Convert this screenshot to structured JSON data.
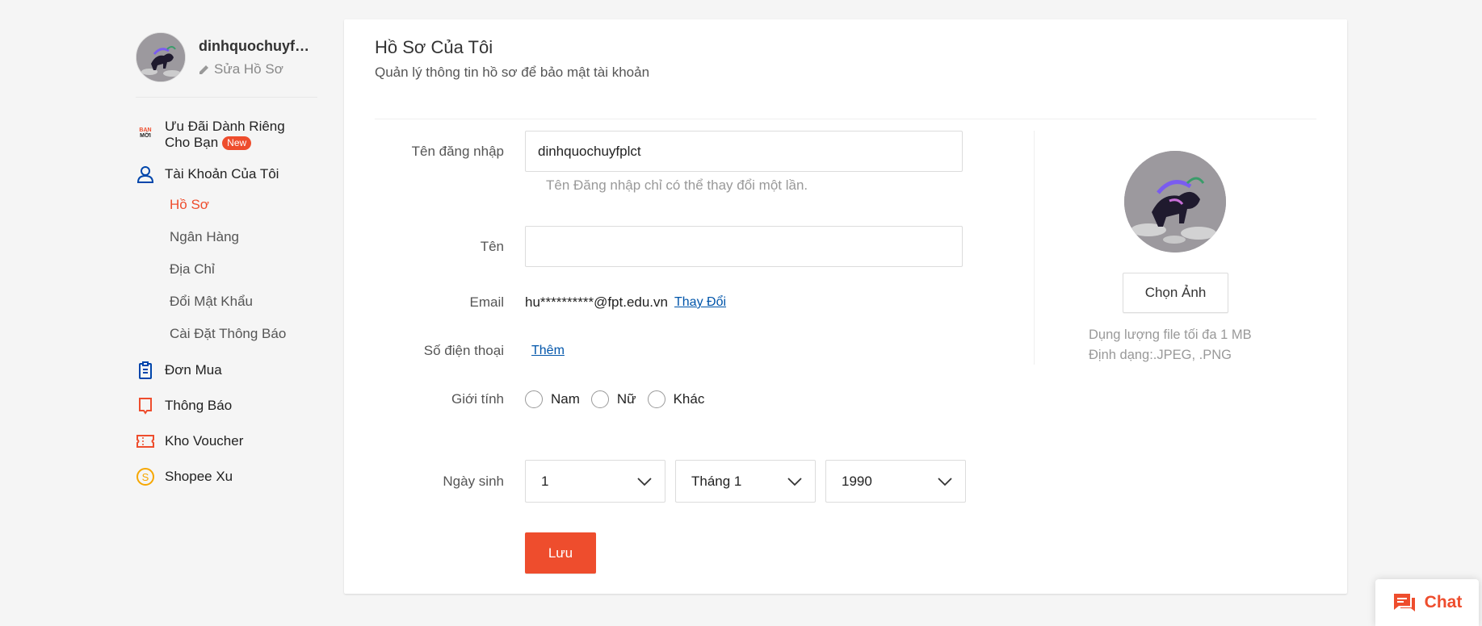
{
  "user": {
    "username": "dinhquochuyfplct",
    "edit_profile": "Sửa Hồ Sơ"
  },
  "sidebar": {
    "promo_icon_text": [
      "BẠN",
      "MỚI"
    ],
    "promo_label_line1": "Ưu Đãi Dành Riêng",
    "promo_label_line2": "Cho Bạn",
    "promo_badge": "New",
    "account": "Tài Khoản Của Tôi",
    "account_items": [
      {
        "label": "Hồ Sơ",
        "active": true
      },
      {
        "label": "Ngân Hàng",
        "active": false
      },
      {
        "label": "Địa Chỉ",
        "active": false
      },
      {
        "label": "Đổi Mật Khẩu",
        "active": false
      },
      {
        "label": "Cài Đặt Thông Báo",
        "active": false
      }
    ],
    "orders": "Đơn Mua",
    "notifications": "Thông Báo",
    "vouchers": "Kho Voucher",
    "coins": "Shopee Xu"
  },
  "header": {
    "title": "Hồ Sơ Của Tôi",
    "subtitle": "Quản lý thông tin hồ sơ để bảo mật tài khoản"
  },
  "form": {
    "username_label": "Tên đăng nhập",
    "username_value": "dinhquochuyfplct",
    "username_hint": "Tên Đăng nhập chỉ có thể thay đổi một lần.",
    "name_label": "Tên",
    "name_value": "",
    "email_label": "Email",
    "email_value": "hu**********@fpt.edu.vn",
    "email_change": "Thay Đổi",
    "phone_label": "Số điện thoại",
    "phone_add": "Thêm",
    "gender_label": "Giới tính",
    "gender_options": [
      "Nam",
      "Nữ",
      "Khác"
    ],
    "birthday_label": "Ngày sinh",
    "birthday_day": "1",
    "birthday_month": "Tháng 1",
    "birthday_year": "1990",
    "save": "Lưu"
  },
  "avatar_panel": {
    "choose_button": "Chọn Ảnh",
    "file_size_note": "Dụng lượng file tối đa 1 MB",
    "file_format_note": "Định dạng:.JPEG, .PNG"
  },
  "chat": {
    "label": "Chat"
  },
  "colors": {
    "accent": "#ee4d2d",
    "link": "#0055aa",
    "account_icon": "#0046ab",
    "coins_icon": "#f6a700"
  }
}
